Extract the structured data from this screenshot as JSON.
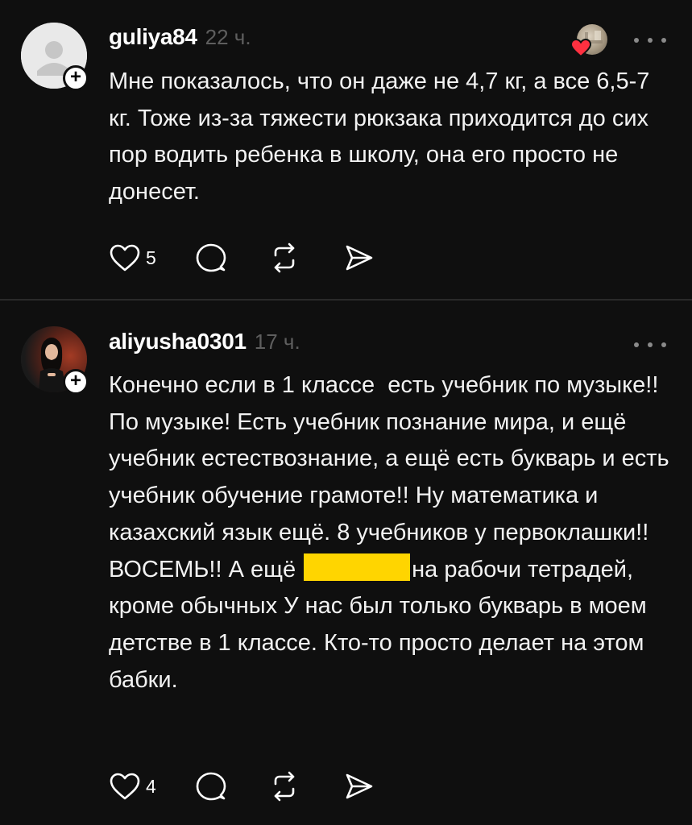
{
  "posts": [
    {
      "username": "guliya84",
      "time": "22 ч.",
      "text": "Мне показалось, что он даже не 4,7 кг, а все 6,5-7 кг. Тоже из-за тяжести рюкзака приходится до сих пор водить ребенка в школу, она его просто не донесет.",
      "likes": "5",
      "avatar": "default-avatar-icon",
      "has_liker_badge": true
    },
    {
      "username": "aliyusha0301",
      "time": "17 ч.",
      "text_part1": "Конечно если в 1 классе  есть учебник по музыке!! По музыке! Есть учебник познание мира, и ещё учебник естествознание, а ещё есть букварь и есть учебник обучение грамоте!! Ну математика и казахский язык ещё. 8 учебников у первоклашки!! ВОСЕМЬ!! А ещё",
      "text_part2": "на рабочи тетрадей, кроме обычных У нас был только букварь в моем детстве в 1 классе. Кто-то просто делает на этом бабки.",
      "likes": "4",
      "avatar": "profile-photo"
    }
  ],
  "icons": {
    "like": "heart-outline-icon",
    "reply": "speech-bubble-icon",
    "repost": "repost-arrows-icon",
    "share": "paper-plane-icon",
    "more": "three-dots-icon",
    "follow": "plus-icon"
  },
  "colors": {
    "background": "#0f0f0f",
    "text": "#f2f2f2",
    "muted": "#5e5e5e",
    "divider": "#2a2a2a",
    "like_red": "#ff3040",
    "redaction": "#ffd500"
  }
}
